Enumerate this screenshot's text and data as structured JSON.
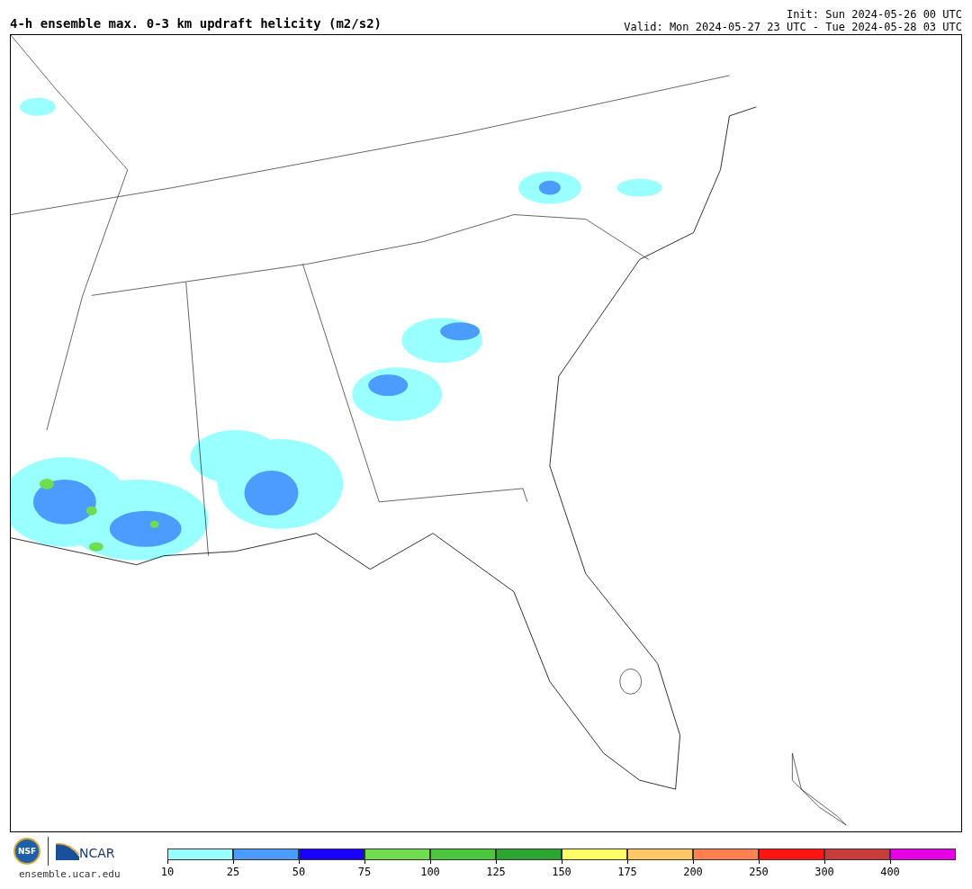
{
  "title": "4-h ensemble max. 0-3 km updraft helicity (m2/s2)",
  "init": "Init: Sun 2024-05-26 00 UTC",
  "valid": "Valid: Mon 2024-05-27 23 UTC - Tue 2024-05-28 03 UTC",
  "logos": {
    "nsf": "NSF",
    "ncar": "NCAR",
    "site": "ensemble.ucar.edu"
  },
  "legend": [
    {
      "label": "10",
      "color": "#99ffff"
    },
    {
      "label": "25",
      "color": "#4c9cff"
    },
    {
      "label": "50",
      "color": "#1a00ff"
    },
    {
      "label": "75",
      "color": "#70dd50"
    },
    {
      "label": "100",
      "color": "#4cc63d"
    },
    {
      "label": "125",
      "color": "#2ca532"
    },
    {
      "label": "150",
      "color": "#ffff66"
    },
    {
      "label": "175",
      "color": "#ffc864"
    },
    {
      "label": "200",
      "color": "#ff8050"
    },
    {
      "label": "250",
      "color": "#ff1414"
    },
    {
      "label": "300",
      "color": "#c83c3c"
    },
    {
      "label": "400",
      "color": "#e600e6"
    }
  ]
}
